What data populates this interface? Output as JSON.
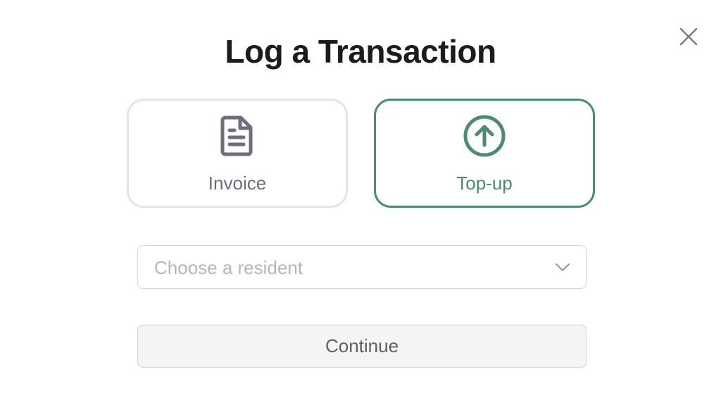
{
  "modal": {
    "title": "Log a Transaction",
    "close_icon": "close-icon"
  },
  "transaction_types": [
    {
      "label": "Invoice",
      "icon": "document-icon",
      "selected": false
    },
    {
      "label": "Top-up",
      "icon": "arrow-up-circle-icon",
      "selected": true
    }
  ],
  "resident_select": {
    "placeholder": "Choose a resident",
    "icon": "chevron-down-icon"
  },
  "actions": {
    "continue_label": "Continue"
  },
  "colors": {
    "accent": "#4a8a76",
    "unselected_border": "#e4e4e6",
    "title_text": "#1c1c1c",
    "muted_text": "#6b6f7b",
    "placeholder_text": "#b6b6b9",
    "button_bg": "#f4f4f4"
  }
}
